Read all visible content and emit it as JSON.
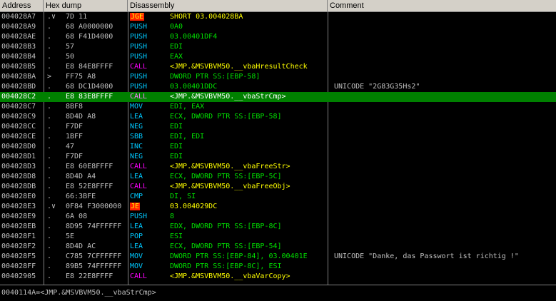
{
  "columns": {
    "address": "Address",
    "hex": "Hex dump",
    "disasm": "Disassembly",
    "comment": "Comment"
  },
  "rows": [
    {
      "addr": "004028A7",
      "mark": ".∨",
      "hex": "7D 11",
      "mn": "JGE",
      "type": "jump",
      "ops": "SHORT 03.004028BA",
      "comment": ""
    },
    {
      "addr": "004028A9",
      "mark": ".",
      "hex": "68 A0000000",
      "mn": "PUSH",
      "type": "norm",
      "ops": "0A0",
      "comment": ""
    },
    {
      "addr": "004028AE",
      "mark": ".",
      "hex": "68 F41D4000",
      "mn": "PUSH",
      "type": "norm",
      "ops": "03.00401DF4",
      "comment": ""
    },
    {
      "addr": "004028B3",
      "mark": ".",
      "hex": "57",
      "mn": "PUSH",
      "type": "norm",
      "ops": "EDI",
      "comment": ""
    },
    {
      "addr": "004028B4",
      "mark": ".",
      "hex": "50",
      "mn": "PUSH",
      "type": "norm",
      "ops": "EAX",
      "comment": ""
    },
    {
      "addr": "004028B5",
      "mark": ".",
      "hex": "E8 84E8FFFF",
      "mn": "CALL",
      "type": "call",
      "ops": "<JMP.&MSVBVM50.__vbaHresultCheck",
      "comment": ""
    },
    {
      "addr": "004028BA",
      "mark": ">",
      "hex": "FF75 A8",
      "mn": "PUSH",
      "type": "norm",
      "ops": "DWORD PTR SS:[EBP-58]",
      "comment": ""
    },
    {
      "addr": "004028BD",
      "mark": ".",
      "hex": "68 DC1D4000",
      "mn": "PUSH",
      "type": "norm",
      "ops": "03.00401DDC",
      "comment": "UNICODE \"2G83G35Hs2\""
    },
    {
      "addr": "004028C2",
      "mark": ".",
      "hex": "E8 83E8FFFF",
      "mn": "CALL",
      "type": "call",
      "ops": "<JMP.&MSVBVM50.__vbaStrCmp>",
      "comment": "",
      "selected": true
    },
    {
      "addr": "004028C7",
      "mark": ".",
      "hex": "8BF8",
      "mn": "MOV",
      "type": "norm",
      "ops": "EDI, EAX",
      "comment": ""
    },
    {
      "addr": "004028C9",
      "mark": ".",
      "hex": "8D4D A8",
      "mn": "LEA",
      "type": "norm",
      "ops": "ECX, DWORD PTR SS:[EBP-58]",
      "comment": ""
    },
    {
      "addr": "004028CC",
      "mark": ".",
      "hex": "F7DF",
      "mn": "NEG",
      "type": "norm",
      "ops": "EDI",
      "comment": ""
    },
    {
      "addr": "004028CE",
      "mark": ".",
      "hex": "1BFF",
      "mn": "SBB",
      "type": "norm",
      "ops": "EDI, EDI",
      "comment": ""
    },
    {
      "addr": "004028D0",
      "mark": ".",
      "hex": "47",
      "mn": "INC",
      "type": "norm",
      "ops": "EDI",
      "comment": ""
    },
    {
      "addr": "004028D1",
      "mark": ".",
      "hex": "F7DF",
      "mn": "NEG",
      "type": "norm",
      "ops": "EDI",
      "comment": ""
    },
    {
      "addr": "004028D3",
      "mark": ".",
      "hex": "E8 60E8FFFF",
      "mn": "CALL",
      "type": "call",
      "ops": "<JMP.&MSVBVM50.__vbaFreeStr>",
      "comment": ""
    },
    {
      "addr": "004028D8",
      "mark": ".",
      "hex": "8D4D A4",
      "mn": "LEA",
      "type": "norm",
      "ops": "ECX, DWORD PTR SS:[EBP-5C]",
      "comment": ""
    },
    {
      "addr": "004028DB",
      "mark": ".",
      "hex": "E8 52E8FFFF",
      "mn": "CALL",
      "type": "call",
      "ops": "<JMP.&MSVBVM50.__vbaFreeObj>",
      "comment": ""
    },
    {
      "addr": "004028E0",
      "mark": ".",
      "hex": "66:3BFE",
      "mn": "CMP",
      "type": "norm",
      "ops": "DI, SI",
      "comment": ""
    },
    {
      "addr": "004028E3",
      "mark": ".∨",
      "hex": "0F84 F3000000",
      "mn": "JE",
      "type": "jump",
      "ops": "03.004029DC",
      "comment": ""
    },
    {
      "addr": "004028E9",
      "mark": ".",
      "hex": "6A 08",
      "mn": "PUSH",
      "type": "norm",
      "ops": "8",
      "comment": ""
    },
    {
      "addr": "004028EB",
      "mark": ".",
      "hex": "8D95 74FFFFFF",
      "mn": "LEA",
      "type": "norm",
      "ops": "EDX, DWORD PTR SS:[EBP-8C]",
      "comment": ""
    },
    {
      "addr": "004028F1",
      "mark": ".",
      "hex": "5E",
      "mn": "POP",
      "type": "norm",
      "ops": "ESI",
      "comment": ""
    },
    {
      "addr": "004028F2",
      "mark": ".",
      "hex": "8D4D AC",
      "mn": "LEA",
      "type": "norm",
      "ops": "ECX, DWORD PTR SS:[EBP-54]",
      "comment": ""
    },
    {
      "addr": "004028F5",
      "mark": ".",
      "hex": "C785 7CFFFFFF",
      "mn": "MOV",
      "type": "norm",
      "ops": "DWORD PTR SS:[EBP-84], 03.00401E",
      "comment": "UNICODE \"Danke, das Passwort ist richtig !\""
    },
    {
      "addr": "004028FF",
      "mark": ".",
      "hex": "89B5 74FFFFFF",
      "mn": "MOV",
      "type": "norm",
      "ops": "DWORD PTR SS:[EBP-8C], ESI",
      "comment": ""
    },
    {
      "addr": "00402905",
      "mark": ".",
      "hex": "E8 22E8FFFF",
      "mn": "CALL",
      "type": "call",
      "ops": "<JMP.&MSVBVM50.__vbaVarCopy>",
      "comment": ""
    }
  ],
  "status": "0040114A=<JMP.&MSVBVM50.__vbaStrCmp>"
}
